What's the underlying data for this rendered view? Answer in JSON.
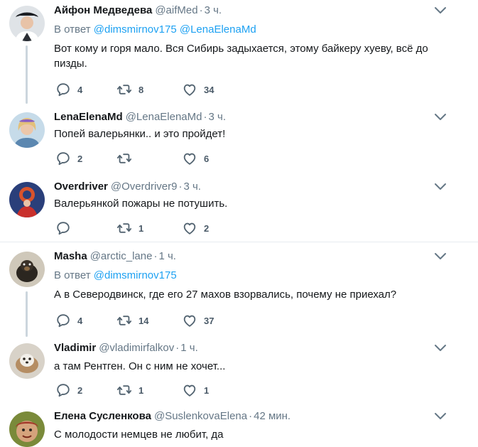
{
  "tweets": [
    {
      "name": "Айфон Медведева",
      "handle": "@aifMed",
      "dot": "·",
      "time": "3 ч.",
      "reply_label": "В ответ",
      "mentions": [
        "@dimsmirnov175",
        "@LenaElenaMd"
      ],
      "text": "Вот кому и горя мало. Вся Сибирь задыхается, этому байкеру хуеву, всё до пизды.",
      "replies": "4",
      "retweets": "8",
      "likes": "34"
    },
    {
      "name": "LenaElenaMd",
      "handle": "@LenaElenaMd",
      "dot": "·",
      "time": "3 ч.",
      "text": "Попей валерьянки.. и это пройдет!",
      "replies": "2",
      "retweets": "",
      "likes": "6"
    },
    {
      "name": "Overdriver",
      "handle": "@Overdriver9",
      "dot": "·",
      "time": "3 ч.",
      "text": "Валерьянкой пожары не потушить.",
      "replies": "",
      "retweets": "1",
      "likes": "2"
    },
    {
      "name": "Masha",
      "handle": "@arctic_lane",
      "dot": "·",
      "time": "1 ч.",
      "reply_label": "В ответ",
      "mentions": [
        "@dimsmirnov175"
      ],
      "text": "А в Северодвинск, где его 27 махов взорвались, почему не приехал?",
      "replies": "4",
      "retweets": "14",
      "likes": "37"
    },
    {
      "name": "Vladimir",
      "handle": "@vladimirfalkov",
      "dot": "·",
      "time": "1 ч.",
      "text": "а там Рентген. Он с ним не хочет...",
      "replies": "2",
      "retweets": "1",
      "likes": "1"
    },
    {
      "name": "Елена Сусленкова",
      "handle": "@SuslenkovaElena",
      "dot": "·",
      "time": "42 мин.",
      "text": "С молодости немцев не любит, да"
    }
  ],
  "colors": {
    "link": "#1da1f2",
    "secondary": "#657786",
    "divider": "#e6ecf0",
    "thread_line": "#ccd6dd"
  },
  "icons": {
    "reply": "reply-icon",
    "retweet": "retweet-icon",
    "like": "heart-icon",
    "more": "chevron-down-icon"
  }
}
